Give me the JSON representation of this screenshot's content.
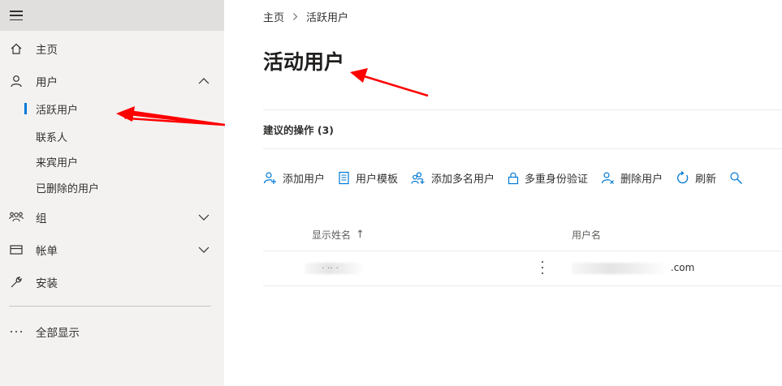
{
  "sidebar": {
    "nav": {
      "home": "主页",
      "users": "用户",
      "users_sub": [
        "活跃用户",
        "联系人",
        "来宾用户",
        "已删除的用户"
      ],
      "groups": "组",
      "billing": "帐单",
      "setup": "安装",
      "show_all": "全部显示"
    }
  },
  "main": {
    "breadcrumb": [
      "主页",
      "活跃用户"
    ],
    "title": "活动用户",
    "suggested_actions": "建议的操作 (3)",
    "toolbar": [
      "添加用户",
      "用户模板",
      "添加多名用户",
      "多重身份验证",
      "删除用户",
      "刷新"
    ],
    "columns": {
      "display_name": "显示姓名",
      "sort_arrow": "↑",
      "username": "用户名"
    },
    "rows": [
      {
        "display_name_visible": "· ·· ·",
        "username_visible": ".com"
      }
    ]
  },
  "colors": {
    "accent": "#0078d4",
    "annotation": "#ff0000"
  }
}
